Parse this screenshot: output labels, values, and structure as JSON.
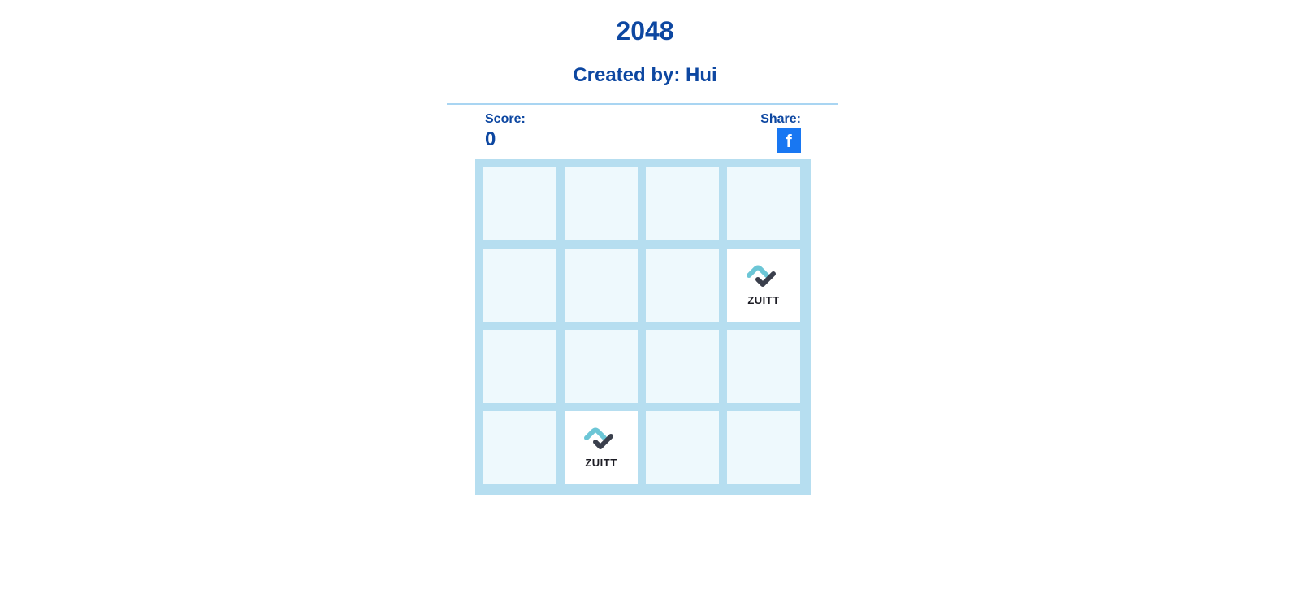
{
  "header": {
    "title": "2048",
    "subtitle": "Created by: Hui"
  },
  "score": {
    "label": "Score:",
    "value": "0"
  },
  "share": {
    "label": "Share:",
    "facebook_glyph": "f",
    "icon": "facebook-icon"
  },
  "board": {
    "rows": 4,
    "cols": 4,
    "tiles": [
      [
        "",
        "",
        "",
        ""
      ],
      [
        "",
        "",
        "",
        "ZUITT"
      ],
      [
        "",
        "",
        "",
        ""
      ],
      [
        "",
        "ZUITT",
        "",
        ""
      ]
    ]
  },
  "colors": {
    "text": "#0d47a1",
    "board_bg": "#b6def0",
    "empty_cell": "#eef9fd",
    "tile_bg": "#ffffff",
    "facebook": "#1877f2",
    "logo_teal": "#6cc6d6",
    "logo_dark": "#3a3f4c"
  }
}
